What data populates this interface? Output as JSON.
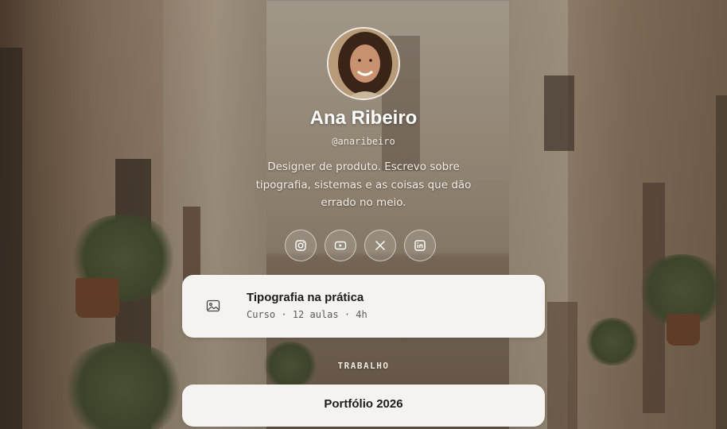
{
  "profile": {
    "name": "Ana Ribeiro",
    "handle": "@anaribeiro",
    "bio": "Designer de produto. Escrevo sobre tipografia, sistemas e as coisas que dão errado no meio."
  },
  "socials": [
    {
      "icon": "instagram-icon"
    },
    {
      "icon": "youtube-icon"
    },
    {
      "icon": "x-icon"
    },
    {
      "icon": "linkedin-icon"
    }
  ],
  "links": {
    "featured": {
      "icon": "image-icon",
      "title": "Tipografia na prática",
      "subtitle": "Curso · 12 aulas · 4h"
    },
    "section_label": "TRABALHO",
    "items": [
      {
        "title": "Portfólio 2026"
      }
    ]
  },
  "colors": {
    "card_background": "#f5f3ef",
    "text_primary": "#1e1b18",
    "text_on_background": "#ffffff"
  }
}
